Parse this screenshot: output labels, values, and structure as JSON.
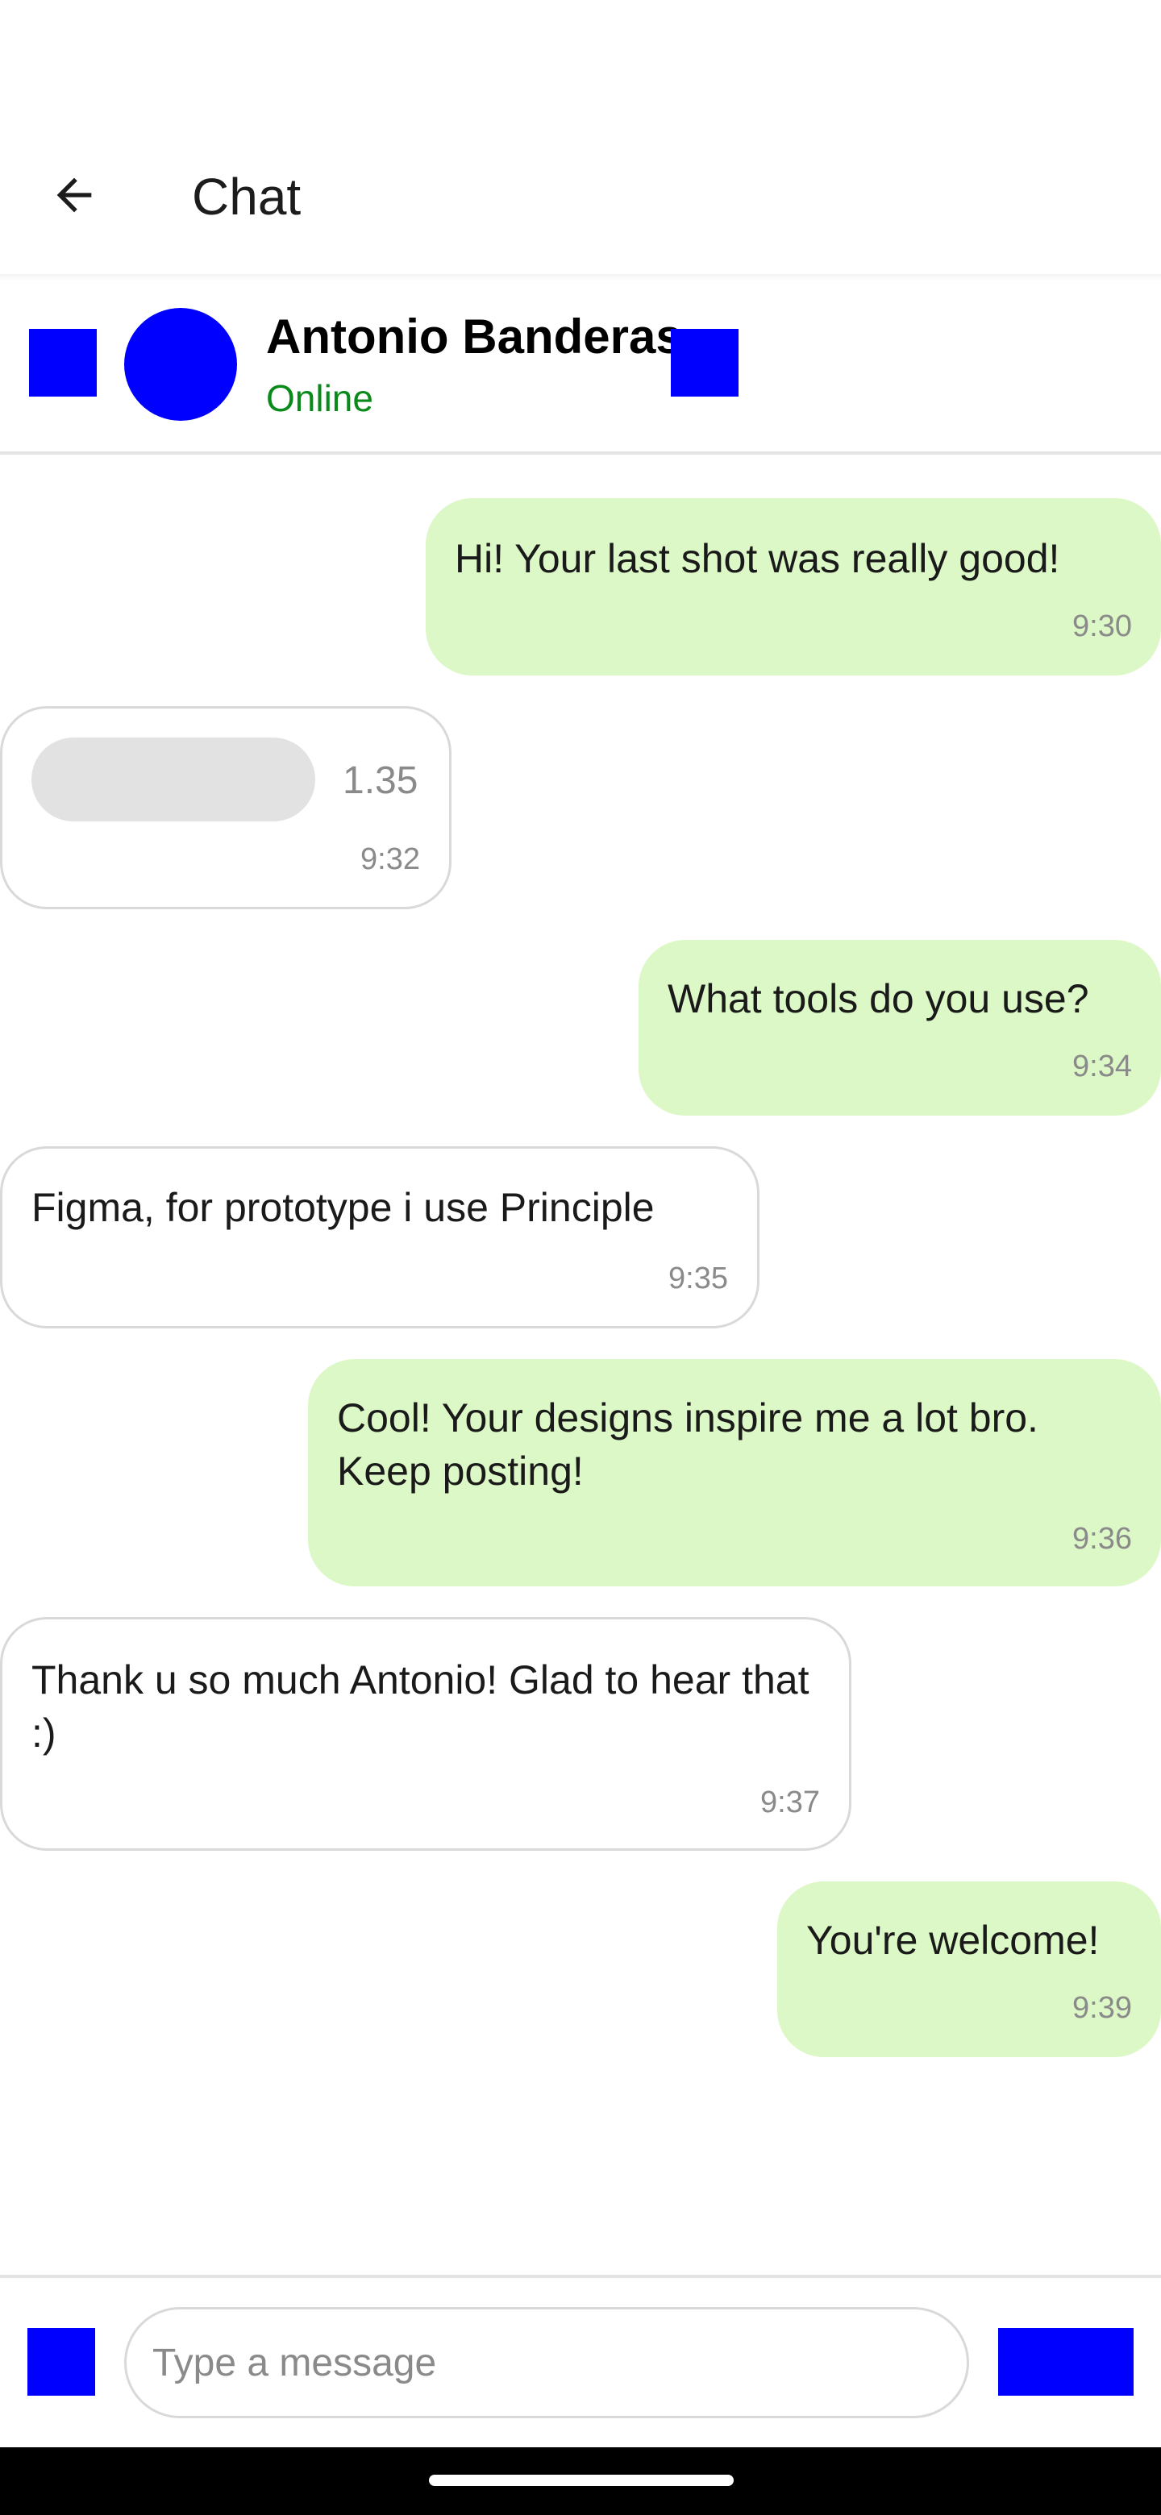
{
  "app_bar": {
    "title": "Chat",
    "back_icon": "arrow-back-icon"
  },
  "contact": {
    "name": "Antonio Banderas",
    "status": "Online",
    "status_color": "#0a8a1a"
  },
  "accent_color": "#0000ff",
  "messages": [
    {
      "type": "sent",
      "text": "Hi! Your last shot was really good!",
      "time": "9:30"
    },
    {
      "type": "received-voice",
      "duration": "1.35",
      "time": "9:32"
    },
    {
      "type": "sent",
      "text": "What tools do you use?",
      "time": "9:34"
    },
    {
      "type": "received",
      "text": "Figma, for prototype i use Principle",
      "time": "9:35"
    },
    {
      "type": "sent",
      "text": "Cool! Your designs inspire me a lot bro. Keep posting!",
      "time": "9:36"
    },
    {
      "type": "received",
      "text": "Thank u so much Antonio! Glad to hear that :)",
      "time": "9:37"
    },
    {
      "type": "sent",
      "text": "You're welcome!",
      "time": "9:39"
    }
  ],
  "composer": {
    "placeholder": "Type a message"
  }
}
